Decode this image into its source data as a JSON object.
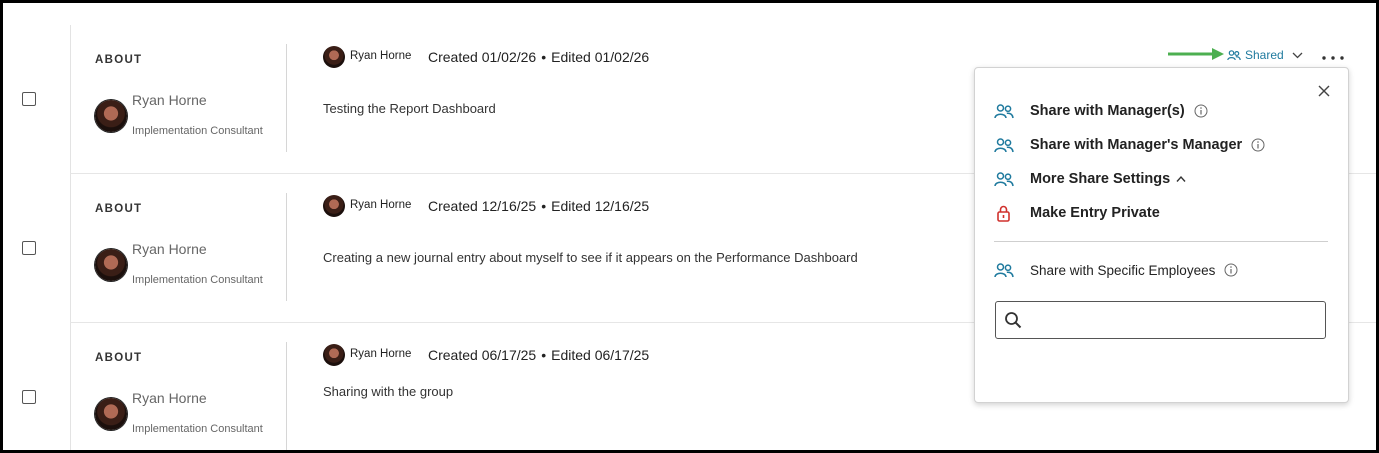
{
  "entries": [
    {
      "about_label": "ABOUT",
      "about_name": "Ryan Horne",
      "about_title": "Implementation Consultant",
      "author": "Ryan Horne",
      "created": "Created 01/02/26",
      "edited": "Edited 01/02/26",
      "text": "Testing the Report Dashboard"
    },
    {
      "about_label": "ABOUT",
      "about_name": "Ryan Horne",
      "about_title": "Implementation Consultant",
      "author": "Ryan Horne",
      "created": "Created 12/16/25",
      "edited": "Edited 12/16/25",
      "text": "Creating a new journal entry about myself to see if it appears on the Performance Dashboard"
    },
    {
      "about_label": "ABOUT",
      "about_name": "Ryan Horne",
      "about_title": "Implementation Consultant",
      "author": "Ryan Horne",
      "created": "Created 06/17/25",
      "edited": "Edited 06/17/25",
      "text": "Sharing with the group"
    }
  ],
  "meta_separator": "•",
  "shared_button": {
    "label": "Shared",
    "icon": "people-icon",
    "color": "#1f7a9e"
  },
  "more_button": {
    "label": "...",
    "icon": "more-horizontal-icon"
  },
  "annotation_arrow_color": "#4caf50",
  "share_menu": {
    "items": [
      {
        "label": "Share with Manager(s)",
        "icon": "people-icon",
        "has_info": true
      },
      {
        "label": "Share with Manager's Manager",
        "icon": "people-icon",
        "has_info": true
      },
      {
        "label": "More Share Settings",
        "icon": "people-icon",
        "expanded": true
      },
      {
        "label": "Make Entry Private",
        "icon": "lock-icon",
        "icon_color": "#d0312d"
      }
    ],
    "specific_label": "Share with Specific Employees",
    "search_placeholder": ""
  }
}
